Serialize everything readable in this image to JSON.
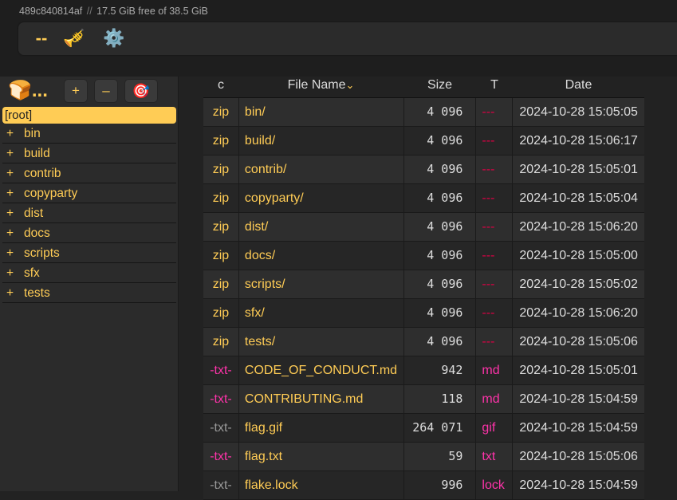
{
  "server": {
    "host": "489c840814af",
    "separator": "//",
    "disk": "17.5 GiB free of 38.5 GiB"
  },
  "ops": {
    "dash_label": "--",
    "horn_icon": "🎺",
    "gear_icon": "⚙️"
  },
  "tree": {
    "breadcrumb": "🍞...",
    "plus_label": "+",
    "minus_label": "–",
    "target_icon": "🎯",
    "root_label": "[root]",
    "expand_symbol": "+",
    "items": [
      {
        "label": "bin"
      },
      {
        "label": "build"
      },
      {
        "label": "contrib"
      },
      {
        "label": "copyparty"
      },
      {
        "label": "dist"
      },
      {
        "label": "docs"
      },
      {
        "label": "scripts"
      },
      {
        "label": "sfx"
      },
      {
        "label": "tests"
      }
    ]
  },
  "files": {
    "headers": {
      "c": "c",
      "name": "File Name",
      "sort_arrow": "⌄",
      "size": "Size",
      "type": "T",
      "date": "Date"
    },
    "rows": [
      {
        "c": "zip",
        "name": "bin/",
        "size": "4 096",
        "type": "---",
        "date": "2024-10-28 15:05:05"
      },
      {
        "c": "zip",
        "name": "build/",
        "size": "4 096",
        "type": "---",
        "date": "2024-10-28 15:06:17"
      },
      {
        "c": "zip",
        "name": "contrib/",
        "size": "4 096",
        "type": "---",
        "date": "2024-10-28 15:05:01"
      },
      {
        "c": "zip",
        "name": "copyparty/",
        "size": "4 096",
        "type": "---",
        "date": "2024-10-28 15:05:04"
      },
      {
        "c": "zip",
        "name": "dist/",
        "size": "4 096",
        "type": "---",
        "date": "2024-10-28 15:06:20"
      },
      {
        "c": "zip",
        "name": "docs/",
        "size": "4 096",
        "type": "---",
        "date": "2024-10-28 15:05:00"
      },
      {
        "c": "zip",
        "name": "scripts/",
        "size": "4 096",
        "type": "---",
        "date": "2024-10-28 15:05:02"
      },
      {
        "c": "zip",
        "name": "sfx/",
        "size": "4 096",
        "type": "---",
        "date": "2024-10-28 15:06:20"
      },
      {
        "c": "zip",
        "name": "tests/",
        "size": "4 096",
        "type": "---",
        "date": "2024-10-28 15:05:06"
      },
      {
        "c": "-txt-",
        "name": "CODE_OF_CONDUCT.md",
        "size": "942",
        "type": "md",
        "date": "2024-10-28 15:05:01"
      },
      {
        "c": "-txt-",
        "name": "CONTRIBUTING.md",
        "size": "118",
        "type": "md",
        "date": "2024-10-28 15:04:59"
      },
      {
        "c": "-txt-",
        "name": "flag.gif",
        "size": "264 071",
        "type": "gif",
        "date": "2024-10-28 15:04:59"
      },
      {
        "c": "-txt-",
        "name": "flag.txt",
        "size": "59",
        "type": "txt",
        "date": "2024-10-28 15:05:06"
      },
      {
        "c": "-txt-",
        "name": "flake.lock",
        "size": "996",
        "type": "lock",
        "date": "2024-10-28 15:04:59"
      }
    ]
  },
  "colors": {
    "accent": "#ffcc55",
    "pink": "#ff33aa",
    "background": "#222222"
  }
}
